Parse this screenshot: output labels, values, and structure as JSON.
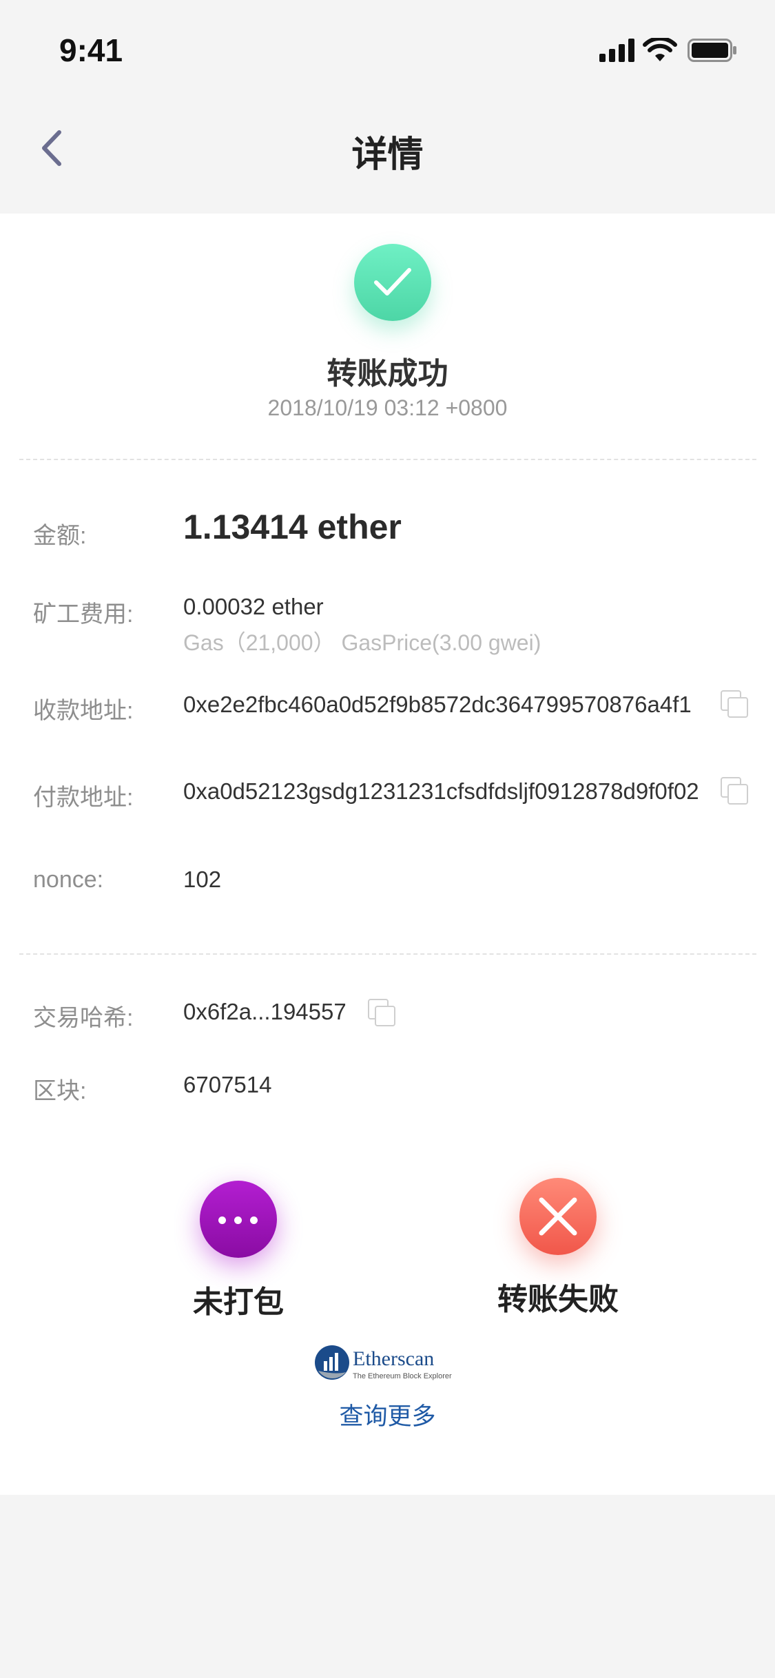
{
  "status_bar": {
    "time": "9:41"
  },
  "nav": {
    "title": "详情"
  },
  "status": {
    "title": "转账成功",
    "timestamp": "2018/10/19 03:12  +0800",
    "icon": "check-circle-icon",
    "color": "#4dd6a6"
  },
  "details": {
    "amount": {
      "label": "金额:",
      "value": "1.13414 ether"
    },
    "fee": {
      "label": "矿工费用:",
      "value": "0.00032 ether",
      "sub": "Gas（21,000）  GasPrice(3.00 gwei)"
    },
    "to_address": {
      "label": "收款地址:",
      "value": "0xe2e2fbc460a0d52f9b8572dc364799570876a4f1"
    },
    "from_address": {
      "label": "付款地址:",
      "value": "0xa0d52123gsdg1231231cfsdfdsljf0912878d9f0f02"
    },
    "nonce": {
      "label": "nonce:",
      "value": "102"
    },
    "tx_hash": {
      "label": "交易哈希:",
      "value": "0x6f2a...194557"
    },
    "block": {
      "label": "区块:",
      "value": "6707514"
    }
  },
  "actions": {
    "pending": {
      "label": "未打包",
      "color": "#a11bbd"
    },
    "failed": {
      "label": "转账失败",
      "color": "#f1574a"
    }
  },
  "explorer": {
    "name": "Etherscan",
    "tagline": "The Ethereum Block Explorer",
    "link_label": "查询更多"
  }
}
